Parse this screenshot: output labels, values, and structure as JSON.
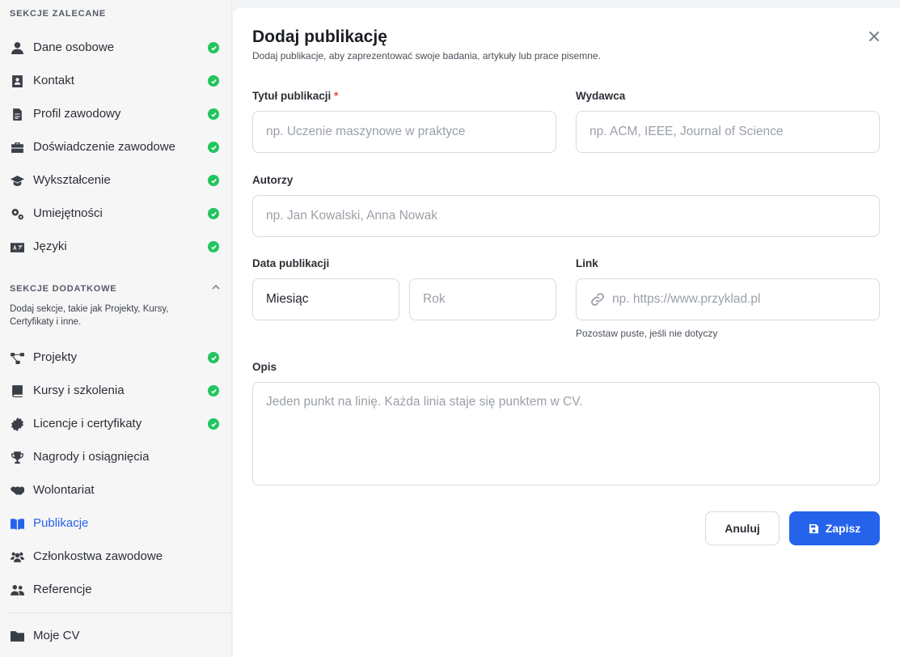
{
  "sidebar": {
    "recommended_header": "SEKCJE ZALECANE",
    "recommended": [
      {
        "label": "Dane osobowe",
        "icon": "user-icon",
        "done": true
      },
      {
        "label": "Kontakt",
        "icon": "contact-card-icon",
        "done": true
      },
      {
        "label": "Profil zawodowy",
        "icon": "document-icon",
        "done": true
      },
      {
        "label": "Doświadczenie zawodowe",
        "icon": "briefcase-icon",
        "done": true
      },
      {
        "label": "Wykształcenie",
        "icon": "graduation-cap-icon",
        "done": true
      },
      {
        "label": "Umiejętności",
        "icon": "gears-icon",
        "done": true
      },
      {
        "label": "Języki",
        "icon": "language-icon",
        "done": true
      }
    ],
    "additional_header": "SEKCJE DODATKOWE",
    "additional_desc": "Dodaj sekcje, takie jak Projekty, Kursy, Certyfikaty i inne.",
    "additional": [
      {
        "label": "Projekty",
        "icon": "project-diagram-icon",
        "done": true
      },
      {
        "label": "Kursy i szkolenia",
        "icon": "book-icon",
        "done": true
      },
      {
        "label": "Licencje i certyfikaty",
        "icon": "certificate-icon",
        "done": true
      },
      {
        "label": "Nagrody i osiągnięcia",
        "icon": "trophy-icon",
        "done": false
      },
      {
        "label": "Wolontariat",
        "icon": "handshake-icon",
        "done": false
      },
      {
        "label": "Publikacje",
        "icon": "open-book-icon",
        "done": false,
        "active": true
      },
      {
        "label": "Członkostwa zawodowe",
        "icon": "users-icon",
        "done": false
      },
      {
        "label": "Referencje",
        "icon": "people-icon",
        "done": false
      }
    ],
    "my_cv": "Moje CV"
  },
  "form": {
    "title": "Dodaj publikację",
    "subtitle": "Dodaj publikacje, aby zaprezentować swoje badania, artykuły lub prace pisemne.",
    "title_label": "Tytuł publikacji",
    "required_mark": "*",
    "title_placeholder": "np. Uczenie maszynowe w praktyce",
    "publisher_label": "Wydawca",
    "publisher_placeholder": "np. ACM, IEEE, Journal of Science",
    "authors_label": "Autorzy",
    "authors_placeholder": "np. Jan Kowalski, Anna Nowak",
    "date_label": "Data publikacji",
    "month_value": "Miesiąc",
    "year_placeholder": "Rok",
    "link_label": "Link",
    "link_placeholder": "np. https://www.przyklad.pl",
    "link_hint": "Pozostaw puste, jeśli nie dotyczy",
    "description_label": "Opis",
    "description_placeholder": "Jeden punkt na linię. Każda linia staje się punktem w CV.",
    "cancel_label": "Anuluj",
    "save_label": "Zapisz"
  },
  "colors": {
    "accent": "#2563eb",
    "check": "#22c55e",
    "required": "#ef4444"
  }
}
